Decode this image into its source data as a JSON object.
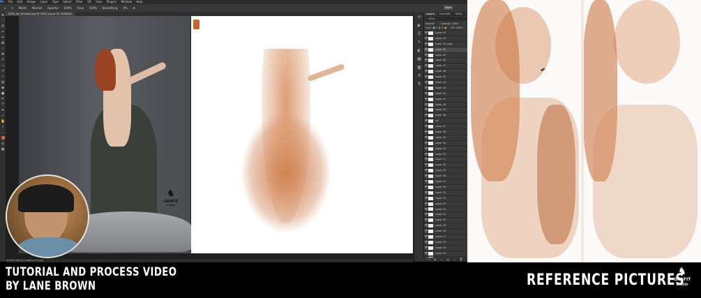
{
  "menubar": {
    "items": [
      "Ps",
      "File",
      "Edit",
      "Image",
      "Layer",
      "Type",
      "Select",
      "Filter",
      "3D",
      "View",
      "Plugins",
      "Window",
      "Help"
    ]
  },
  "options": {
    "mode_label": "Mode:",
    "mode_value": "Normal",
    "opacity_label": "Opacity:",
    "opacity_value": "100%",
    "flow_label": "Flow:",
    "flow_value": "100%",
    "smoothing_label": "Smoothing:",
    "smoothing_value": "0%",
    "share": "Share"
  },
  "document": {
    "tab": "DS25_Re_Trimmed.psd @ 100% (Layer 50, RGB/8#)",
    "status": "33.33%   1000 px x 1000 px (72 ppi)"
  },
  "layers_panel": {
    "tabs": [
      "Layers",
      "Channels",
      "Paths"
    ],
    "search": "Kind",
    "blend": "Normal",
    "opacity": "Opacity: 100%",
    "lock": "Lock:",
    "fill": "Fill: 100%",
    "footer": "fx ◐ ▭ ▤ ＋ 🗑",
    "layers": [
      "Layer 53",
      "Layer 52",
      "Layer 51 copy",
      "Layer 50",
      "Layer 49",
      "Layer 48",
      "Layer 47",
      "Layer 46",
      "Layer 45",
      "Layer 44",
      "Layer 43",
      "Layer 42",
      "Layer 41",
      "Layer 40",
      "Layer 39",
      "Layer 38",
      "ref",
      "Layer 37",
      "Layer 36",
      "Layer 35",
      "Layer 34",
      "Layer 33",
      "Layer 32",
      "Layer 31",
      "Layer 30",
      "Layer 29",
      "Layer 28",
      "Layer 27",
      "Layer 26",
      "Layer 25",
      "Layer 24",
      "Layer 23",
      "Layer 22",
      "Layer 21",
      "Layer 20",
      "Layer 19",
      "Layer 18",
      "Layer 17",
      "Layer 16",
      "Layer 15",
      "Layer 14",
      "Layer 13",
      "Layer 12",
      "Layer 11",
      "Layer 10"
    ],
    "selected_index": 3
  },
  "icons": {
    "toolbar": [
      "move-icon",
      "marquee-icon",
      "lasso-icon",
      "quick-select-icon",
      "crop-icon",
      "frame-icon",
      "eyedropper-icon",
      "healing-icon",
      "brush-icon",
      "stamp-icon",
      "history-brush-icon",
      "eraser-icon",
      "gradient-icon",
      "blur-icon",
      "dodge-icon",
      "pen-icon",
      "type-icon",
      "path-select-icon",
      "rectangle-icon",
      "hand-icon",
      "zoom-icon",
      "more-icon",
      "foreground-color-icon",
      "quick-mask-icon",
      "screen-mode-icon"
    ]
  },
  "photo_logo": {
    "name": "GRAFIT",
    "sub": "STUDIO"
  },
  "banner": {
    "line1": "TUTORIAL AND PROCESS VIDEO",
    "line2": "BY LANE BROWN",
    "reference": "REFERENCE PICTURES",
    "logo_name": "GRAFIT",
    "logo_sub": "STUDIO"
  },
  "colors": {
    "accent_brush": "#c8662d",
    "ps_panel": "#383838",
    "ps_dark": "#2b2b2b"
  }
}
